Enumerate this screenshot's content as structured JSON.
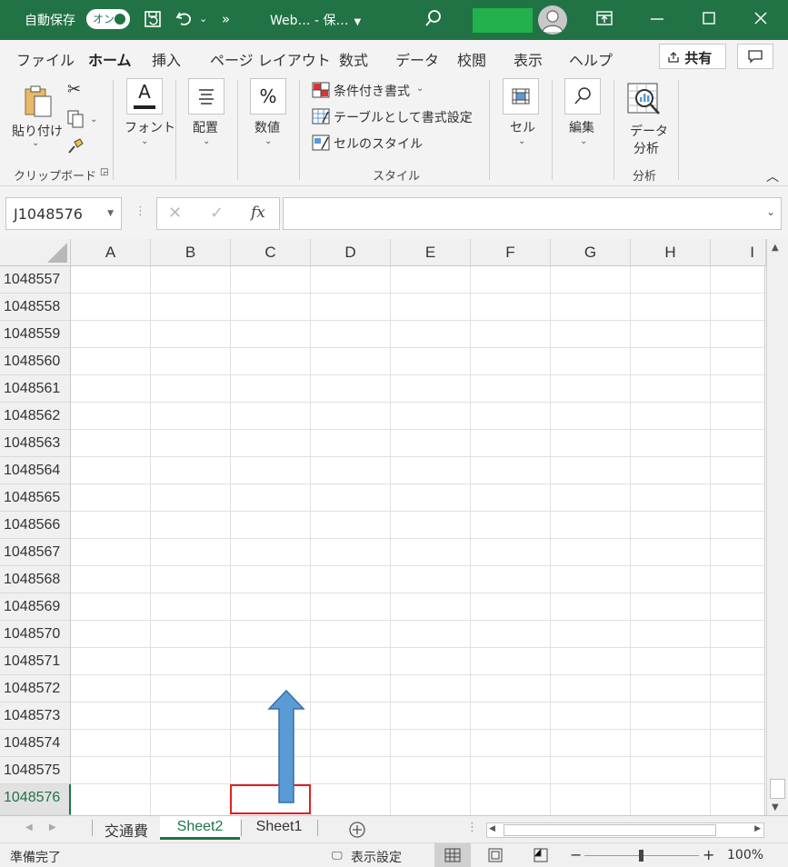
{
  "titlebar": {
    "autosave_label": "自動保存",
    "toggle_label": "オン",
    "doc_title": "Web…  - 保…",
    "more": "»"
  },
  "tabs": [
    "ファイル",
    "ホーム",
    "挿入",
    "ページ レイアウト",
    "数式",
    "データ",
    "校閲",
    "表示",
    "ヘルプ"
  ],
  "active_tab": "ホーム",
  "share_label": "共有",
  "ribbon": {
    "paste": "貼り付け",
    "clipboard": "クリップボード",
    "font": "フォント",
    "align": "配置",
    "number": "数値",
    "cond_format": "条件付き書式",
    "table_format": "テーブルとして書式設定",
    "cell_style": "セルのスタイル",
    "style_group": "スタイル",
    "cells": "セル",
    "edit": "編集",
    "data_analysis_1": "データ",
    "data_analysis_2": "分析",
    "analysis_group": "分析"
  },
  "formula": {
    "name_box": "J1048576",
    "fx": "fx",
    "value": ""
  },
  "columns": [
    "A",
    "B",
    "C",
    "D",
    "E",
    "F",
    "G",
    "H",
    "I"
  ],
  "rows": [
    "1048557",
    "1048558",
    "1048559",
    "1048560",
    "1048561",
    "1048562",
    "1048563",
    "1048564",
    "1048565",
    "1048566",
    "1048567",
    "1048568",
    "1048569",
    "1048570",
    "1048571",
    "1048572",
    "1048573",
    "1048574",
    "1048575",
    "1048576"
  ],
  "selected_row": "1048576",
  "sheets": [
    "交通費",
    "Sheet2",
    "Sheet1"
  ],
  "active_sheet": "Sheet2",
  "status": {
    "ready": "準備完了",
    "display_settings": "表示設定",
    "zoom": "100%"
  },
  "colors": {
    "excel_green": "#217346",
    "annotation_red": "#e02020",
    "arrow_blue": "#5b9bd5"
  }
}
